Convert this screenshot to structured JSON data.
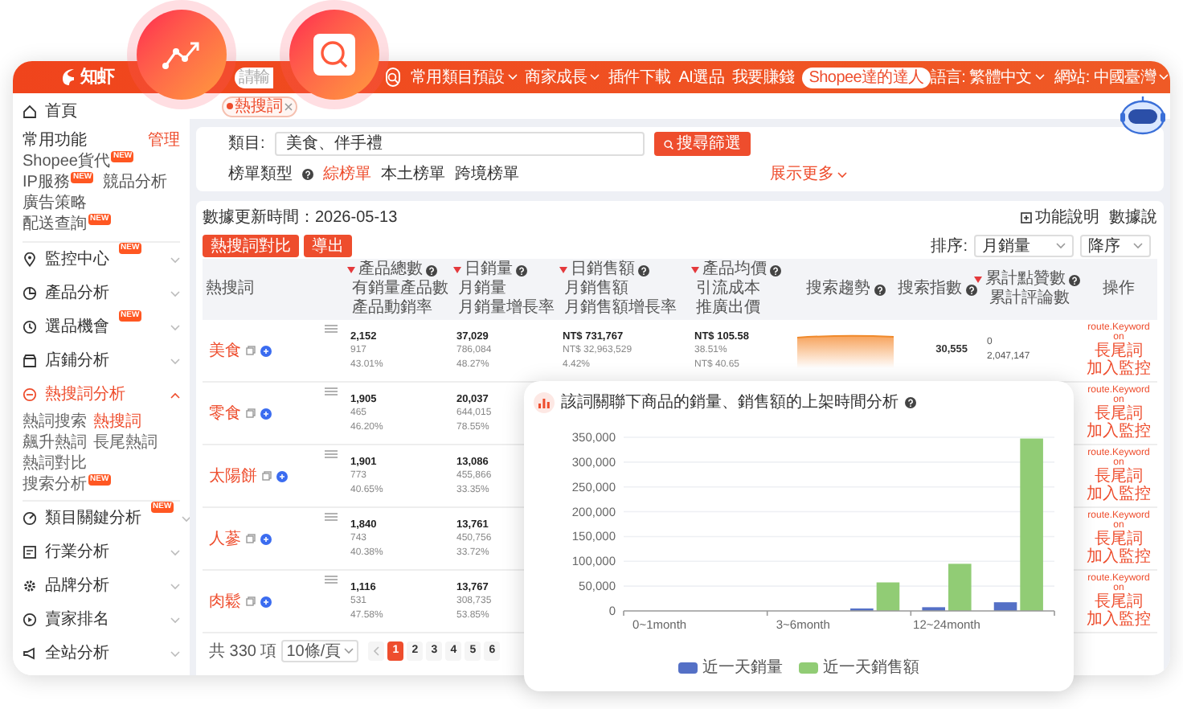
{
  "floating_badges": [
    {
      "kind": "chart"
    },
    {
      "kind": "search"
    }
  ],
  "header": {
    "logo": "知虾",
    "search": {
      "placeholder": "請輸"
    },
    "nav": [
      {
        "label": "常用類目預設",
        "kind": "menu"
      },
      {
        "label": "商家成長",
        "kind": "menu"
      },
      {
        "label": "插件下載",
        "kind": "link"
      },
      {
        "label": "AI選品",
        "kind": "link"
      },
      {
        "label": "我要賺錢",
        "kind": "link"
      },
      {
        "label": "Shopee達的達人",
        "kind": "pill"
      }
    ],
    "settings": [
      {
        "label": "語言: 繁體中文"
      },
      {
        "label": "網站: 中國臺灣"
      }
    ]
  },
  "sidebar": {
    "home": "首頁",
    "favorites": {
      "title": "常用功能",
      "manage": "管理",
      "items": [
        {
          "label": "Shopee貨代",
          "badge": "NEW"
        },
        {
          "label": "IP服務",
          "badge": "NEW"
        },
        {
          "label": "競品分析"
        },
        {
          "label": "廣告策略"
        },
        {
          "label": "配送查詢",
          "badge": "NEW"
        }
      ]
    },
    "menu": [
      {
        "label": "監控中心",
        "badge": "NEW",
        "selected": false,
        "expanded": false
      },
      {
        "label": "產品分析",
        "selected": false,
        "expanded": false
      },
      {
        "label": "選品機會",
        "badge": "NEW",
        "selected": false,
        "expanded": false
      },
      {
        "label": "店鋪分析",
        "selected": false,
        "expanded": false
      },
      {
        "label": "熱搜詞分析",
        "selected": true,
        "expanded": true,
        "children": [
          {
            "label": "熱詞搜索",
            "selected": false
          },
          {
            "label": "熱搜詞",
            "selected": true
          },
          {
            "label": "飆升熱詞",
            "selected": false
          },
          {
            "label": "長尾熱詞",
            "selected": false
          },
          {
            "label": "熱詞對比",
            "selected": false
          },
          {
            "label": "搜索分析",
            "selected": false,
            "badge": "NEW"
          }
        ]
      },
      {
        "label": "類目關鍵分析",
        "badge": "NEW",
        "selected": false,
        "expanded": false
      },
      {
        "label": "行業分析",
        "selected": false,
        "expanded": false
      },
      {
        "label": "品牌分析",
        "selected": false,
        "expanded": false
      },
      {
        "label": "賣家排名",
        "selected": false,
        "expanded": false
      },
      {
        "label": "全站分析",
        "selected": false,
        "expanded": false
      }
    ]
  },
  "tabs": [
    {
      "label": "熱搜詞",
      "selected": true
    }
  ],
  "filter": {
    "category_label": "類目:",
    "category_value": "美食、伴手禮",
    "button": "搜尋篩選",
    "list_type_label": "榜單類型",
    "list_types": [
      {
        "label": "綜榜單",
        "selected": true
      },
      {
        "label": "本土榜單",
        "selected": false
      },
      {
        "label": "跨境榜單",
        "selected": false
      }
    ],
    "more": "展示更多"
  },
  "table_card": {
    "updated": "數據更新時間：2026-05-13",
    "links": [
      "功能說明",
      "數據說"
    ],
    "buttons": [
      "熱搜詞對比",
      "導出"
    ],
    "sort": {
      "label": "排序:",
      "field": "月銷量",
      "order": "降序"
    },
    "columns": [
      {
        "lines": [
          "熱搜詞"
        ]
      },
      {
        "lines": [
          "產品總數",
          "有銷量產品數",
          "產品動銷率"
        ],
        "sortable": true,
        "help": true
      },
      {
        "lines": [
          "日銷量",
          "月銷量",
          "月銷量增長率"
        ],
        "sortable": true,
        "help": true
      },
      {
        "lines": [
          "日銷售額",
          "月銷售額",
          "月銷售額增長率"
        ],
        "sortable": true,
        "help": true
      },
      {
        "lines": [
          "產品均價",
          "引流成本",
          "推廣出價"
        ],
        "sortable": true,
        "help": true
      },
      {
        "lines": [
          "搜索趨勢"
        ],
        "help": true
      },
      {
        "lines": [
          "搜索指數"
        ],
        "help": true
      },
      {
        "lines": [
          "累計點贊數",
          "累計評論數"
        ],
        "sortable": true,
        "help": true
      },
      {
        "lines": [
          "操作"
        ]
      }
    ],
    "rows": [
      {
        "cells": [
          {
            "kind": "keyword",
            "text": "美食"
          },
          {
            "kind": "stack",
            "lines": [
              "2,152",
              "917",
              "43.01%"
            ]
          },
          {
            "kind": "stack",
            "lines": [
              "37,029",
              "786,084",
              "48.27%"
            ]
          },
          {
            "kind": "stack",
            "lines": [
              "NT$ 731,767",
              "NT$ 32,963,529",
              "4.42%"
            ]
          },
          {
            "kind": "stack",
            "lines": [
              "NT$ 105.58",
              "38.51%",
              "NT$ 40.65"
            ]
          },
          {
            "kind": "trend"
          },
          {
            "kind": "value",
            "text": "30,555"
          },
          {
            "kind": "plain",
            "lines": [
              "0",
              "2,047,147"
            ]
          },
          {
            "kind": "actions",
            "links": [
              "route.Keywordon",
              "長尾詞",
              "加入監控"
            ]
          }
        ]
      },
      {
        "cells": [
          {
            "kind": "keyword",
            "text": "零食"
          },
          {
            "kind": "stack",
            "lines": [
              "1,905",
              "465",
              "46.20%"
            ]
          },
          {
            "kind": "stack",
            "lines": [
              "20,037",
              "644,015",
              "78.55%"
            ]
          },
          null,
          null,
          null,
          null,
          null,
          {
            "kind": "actions",
            "links": [
              "route.Keywordon",
              "長尾詞",
              "加入監控"
            ]
          }
        ]
      },
      {
        "cells": [
          {
            "kind": "keyword",
            "text": "太陽餅"
          },
          {
            "kind": "stack",
            "lines": [
              "1,901",
              "773",
              "40.65%"
            ]
          },
          {
            "kind": "stack",
            "lines": [
              "13,086",
              "455,866",
              "33.35%"
            ]
          },
          null,
          null,
          null,
          null,
          null,
          {
            "kind": "actions",
            "links": [
              "route.Keywordon",
              "長尾詞",
              "加入監控"
            ]
          }
        ]
      },
      {
        "cells": [
          {
            "kind": "keyword",
            "text": "人蔘"
          },
          {
            "kind": "stack",
            "lines": [
              "1,840",
              "743",
              "40.38%"
            ]
          },
          {
            "kind": "stack",
            "lines": [
              "13,761",
              "450,756",
              "33.72%"
            ]
          },
          null,
          null,
          null,
          null,
          null,
          {
            "kind": "actions",
            "links": [
              "route.Keywordon",
              "長尾詞",
              "加入監控"
            ]
          }
        ]
      },
      {
        "cells": [
          {
            "kind": "keyword",
            "text": "肉鬆"
          },
          {
            "kind": "stack",
            "lines": [
              "1,116",
              "531",
              "47.58%"
            ]
          },
          {
            "kind": "stack",
            "lines": [
              "13,767",
              "308,735",
              "53.85%"
            ]
          },
          null,
          null,
          null,
          null,
          null,
          {
            "kind": "actions",
            "links": [
              "route.Keywordon",
              "長尾詞",
              "加入監控"
            ]
          }
        ]
      }
    ],
    "pagination": {
      "total": "共 330 項",
      "page_size": "10條/頁",
      "pages": [
        {
          "label": "1",
          "selected": true
        },
        {
          "label": "2",
          "selected": false
        },
        {
          "label": "3",
          "selected": false
        },
        {
          "label": "4",
          "selected": false
        },
        {
          "label": "5",
          "selected": false
        },
        {
          "label": "6",
          "selected": false
        }
      ]
    }
  },
  "chart_panel": {
    "title": "該詞關聯下商品的銷量、銷售額的上架時間分析",
    "chart_data": {
      "type": "bar",
      "grid": true,
      "categories": [
        "0~1month",
        null,
        "3~6month",
        null,
        "12~24month",
        null
      ],
      "series": [
        {
          "name": "近一天銷量",
          "color": "#5470c6",
          "values": [
            0,
            null,
            0,
            5000,
            7500,
            17500
          ]
        },
        {
          "name": "近一天銷售額",
          "color": "#91cc75",
          "values": [
            0,
            null,
            null,
            57500,
            95000,
            347500
          ]
        }
      ],
      "ylim": [
        0,
        350000
      ],
      "yticks": [
        {
          "value": 0,
          "label": "0"
        },
        {
          "value": 50000,
          "label": "50,000"
        },
        {
          "value": 100000,
          "label": "100,000"
        },
        {
          "value": 150000,
          "label": "150,000"
        },
        {
          "value": 200000,
          "label": "200,000"
        },
        {
          "value": 250000,
          "label": "250,000"
        },
        {
          "value": 300000,
          "label": "300,000"
        },
        {
          "value": 350000,
          "label": "350,000"
        }
      ]
    }
  }
}
